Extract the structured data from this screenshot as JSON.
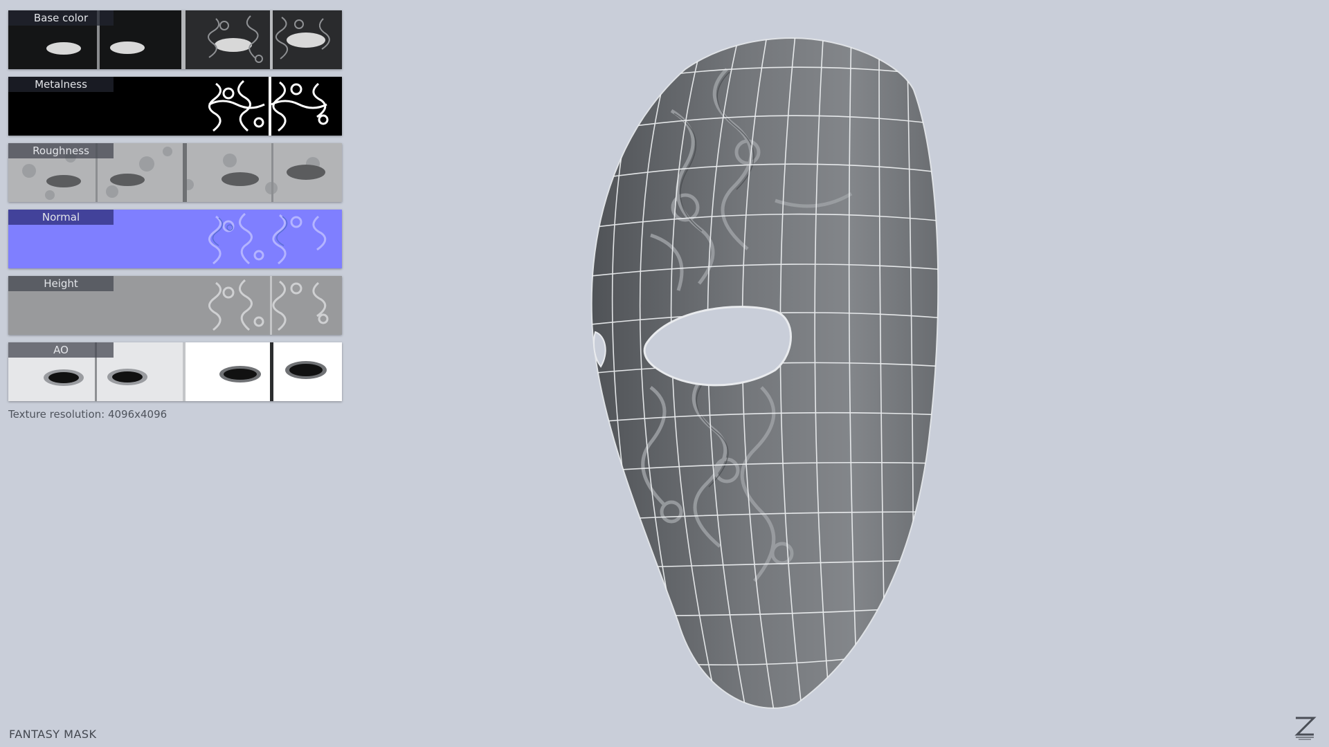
{
  "texture_maps": [
    {
      "label": "Base color",
      "icon": "base-color-map"
    },
    {
      "label": "Metalness",
      "icon": "metalness-map"
    },
    {
      "label": "Roughness",
      "icon": "roughness-map"
    },
    {
      "label": "Normal",
      "icon": "normal-map"
    },
    {
      "label": "Height",
      "icon": "height-map"
    },
    {
      "label": "AO",
      "icon": "ambient-occlusion-map"
    }
  ],
  "texture_resolution": "Texture resolution: 4096x4096",
  "title": "FANTASY MASK",
  "logo_icon": "z-logo-icon",
  "colors": {
    "background": "#c9ced9",
    "normal_map": "#7f7fff",
    "mask_surface": "#6f7276",
    "wireframe": "#f2f4f6"
  }
}
